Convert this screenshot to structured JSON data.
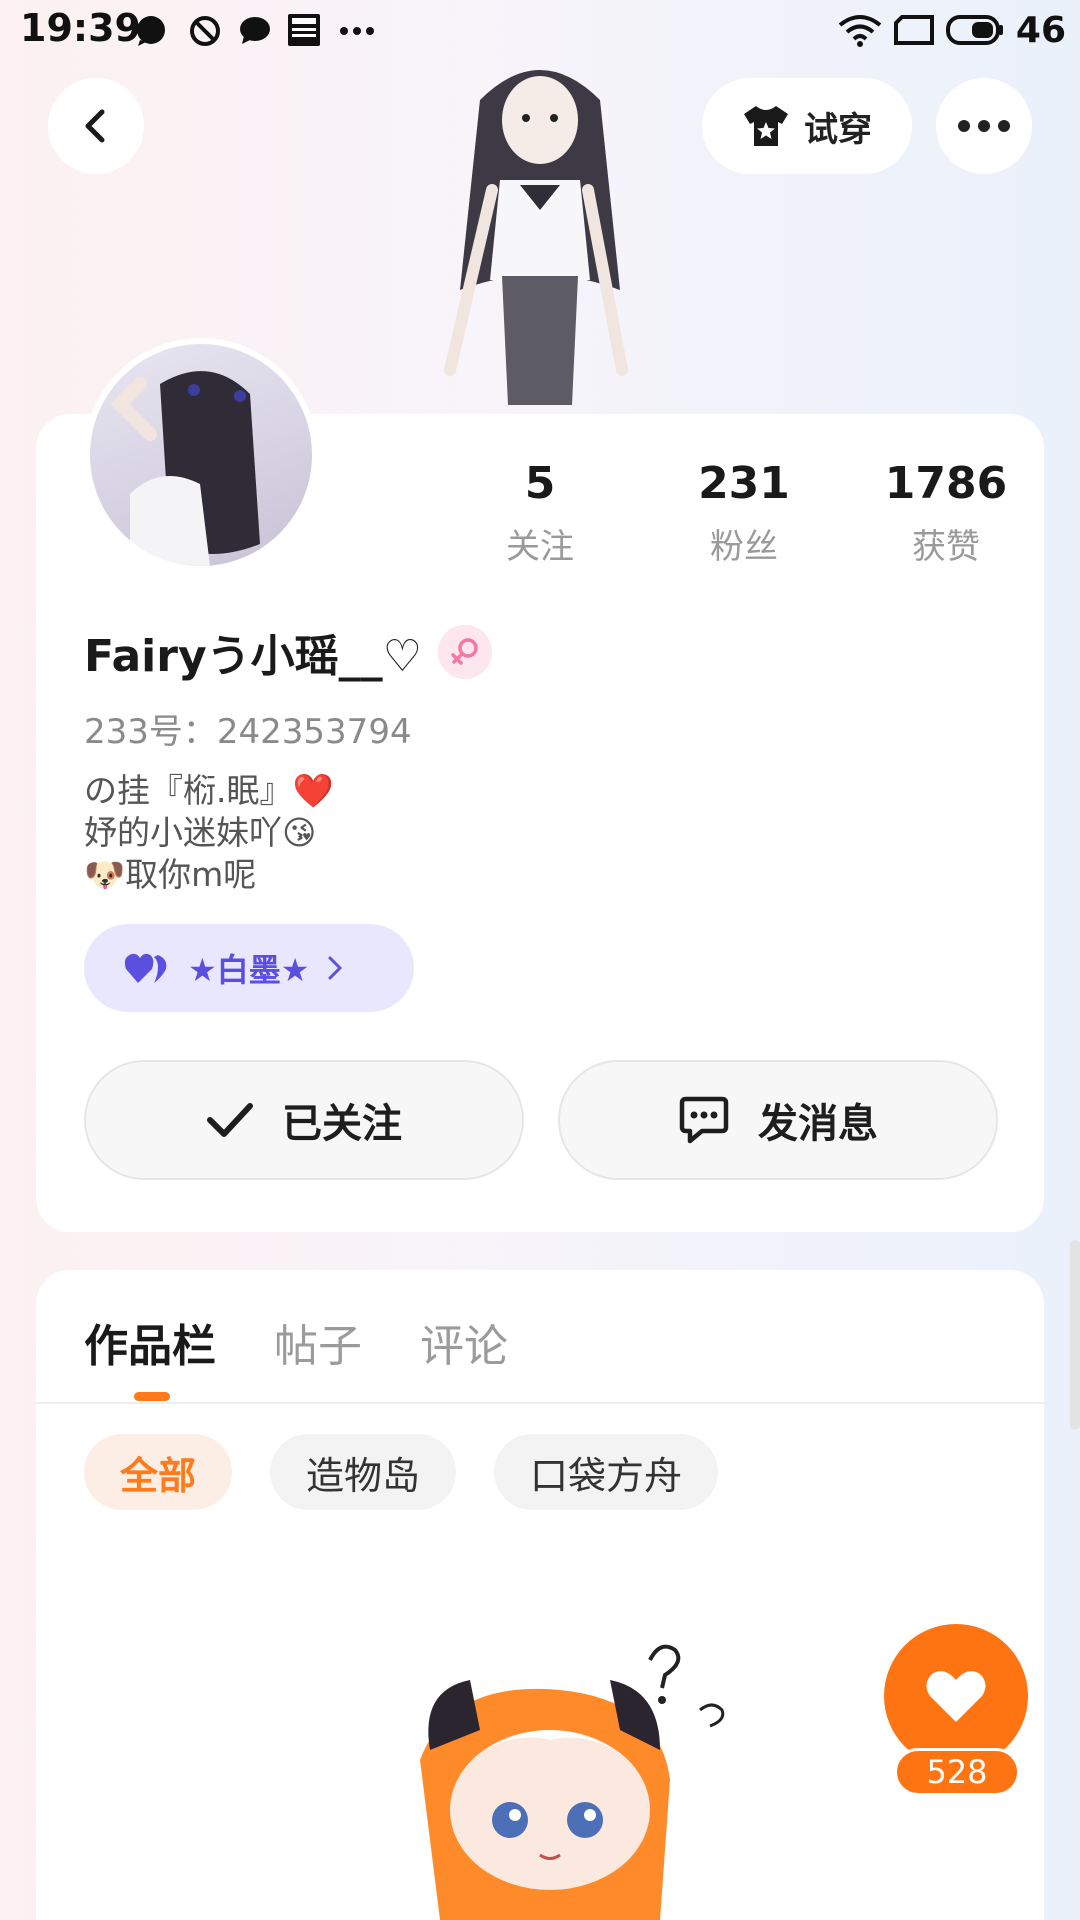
{
  "status_bar": {
    "time": "19:39",
    "battery": "46",
    "icons": [
      "chat-bubble-icon",
      "dnd-icon",
      "message-icon",
      "news-icon",
      "more-dots-icon",
      "wifi-icon",
      "screen-icon",
      "battery-icon"
    ]
  },
  "header": {
    "tryon_label": "试穿"
  },
  "profile": {
    "stats": [
      {
        "value": "5",
        "label": "关注"
      },
      {
        "value": "231",
        "label": "粉丝"
      },
      {
        "value": "1786",
        "label": "获赞"
      }
    ],
    "username": "Fairyう小瑶__♡",
    "user_id": "233号：242353794",
    "bio_lines": [
      "の挂『椼.眠』❤️",
      "妤的小迷妹吖😘",
      "🐶取你m呢"
    ],
    "relation_label": "★白墨★",
    "follow_label": "已关注",
    "message_label": "发消息"
  },
  "content": {
    "tabs": [
      "作品栏",
      "帖子",
      "评论"
    ],
    "active_tab": 0,
    "filters": [
      "全部",
      "造物岛",
      "口袋方舟"
    ],
    "like_count": "528"
  },
  "colors": {
    "accent": "#ff7412",
    "relation_text": "#5b4fe0",
    "relation_bg": "#e9e7fd",
    "gender_bg": "#fde6ee"
  }
}
